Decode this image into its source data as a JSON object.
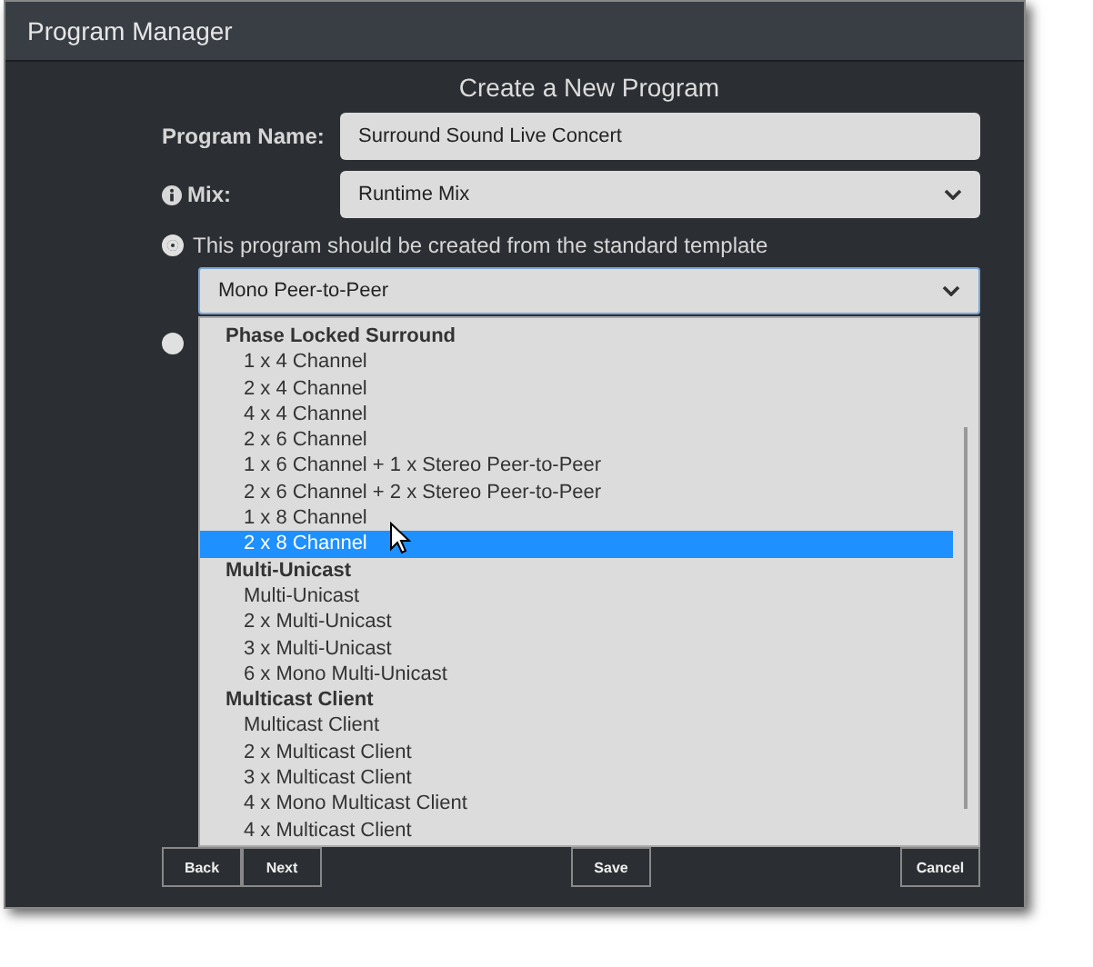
{
  "window": {
    "title": "Program Manager"
  },
  "heading": "Create a New Program",
  "fields": [
    {
      "kind": "text",
      "label": "Program Name:",
      "value": "Surround Sound Live Concert",
      "info": false
    },
    {
      "kind": "select",
      "label": "Mix:",
      "value": "Runtime Mix",
      "info": true
    }
  ],
  "radios": [
    {
      "label": "This program should be created from the standard template",
      "selected": true
    },
    {
      "selected": false
    }
  ],
  "template_select": {
    "value": "Mono Peer-to-Peer",
    "focused": true
  },
  "dropdown": {
    "items": [
      {
        "kind": "group",
        "label": "Phase Locked Surround",
        "selected": false
      },
      {
        "kind": "option",
        "label": "1 x 4 Channel",
        "selected": false
      },
      {
        "kind": "option",
        "label": "2 x 4 Channel",
        "selected": false
      },
      {
        "kind": "option",
        "label": "4 x 4 Channel",
        "selected": false
      },
      {
        "kind": "option",
        "label": "2 x 6 Channel",
        "selected": false
      },
      {
        "kind": "option",
        "label": "1 x 6 Channel + 1 x Stereo Peer-to-Peer",
        "selected": false
      },
      {
        "kind": "option",
        "label": "2 x 6 Channel + 2 x Stereo Peer-to-Peer",
        "selected": false
      },
      {
        "kind": "option",
        "label": "1 x 8 Channel",
        "selected": false
      },
      {
        "kind": "option",
        "label": "2 x 8 Channel",
        "selected": true
      },
      {
        "kind": "group",
        "label": "Multi-Unicast",
        "selected": false
      },
      {
        "kind": "option",
        "label": "Multi-Unicast",
        "selected": false
      },
      {
        "kind": "option",
        "label": "2 x Multi-Unicast",
        "selected": false
      },
      {
        "kind": "option",
        "label": "3 x Multi-Unicast",
        "selected": false
      },
      {
        "kind": "option",
        "label": "6 x Mono Multi-Unicast",
        "selected": false
      },
      {
        "kind": "group",
        "label": "Multicast Client",
        "selected": false
      },
      {
        "kind": "option",
        "label": "Multicast Client",
        "selected": false
      },
      {
        "kind": "option",
        "label": "2 x Multicast Client",
        "selected": false
      },
      {
        "kind": "option",
        "label": "3 x Multicast Client",
        "selected": false
      },
      {
        "kind": "option",
        "label": "4 x Mono Multicast Client",
        "selected": false
      },
      {
        "kind": "option",
        "label": "4 x Multicast Client",
        "selected": false
      }
    ]
  },
  "button_groups": [
    [
      "Back",
      "Next"
    ],
    [
      "Save"
    ],
    [
      "Cancel"
    ]
  ]
}
